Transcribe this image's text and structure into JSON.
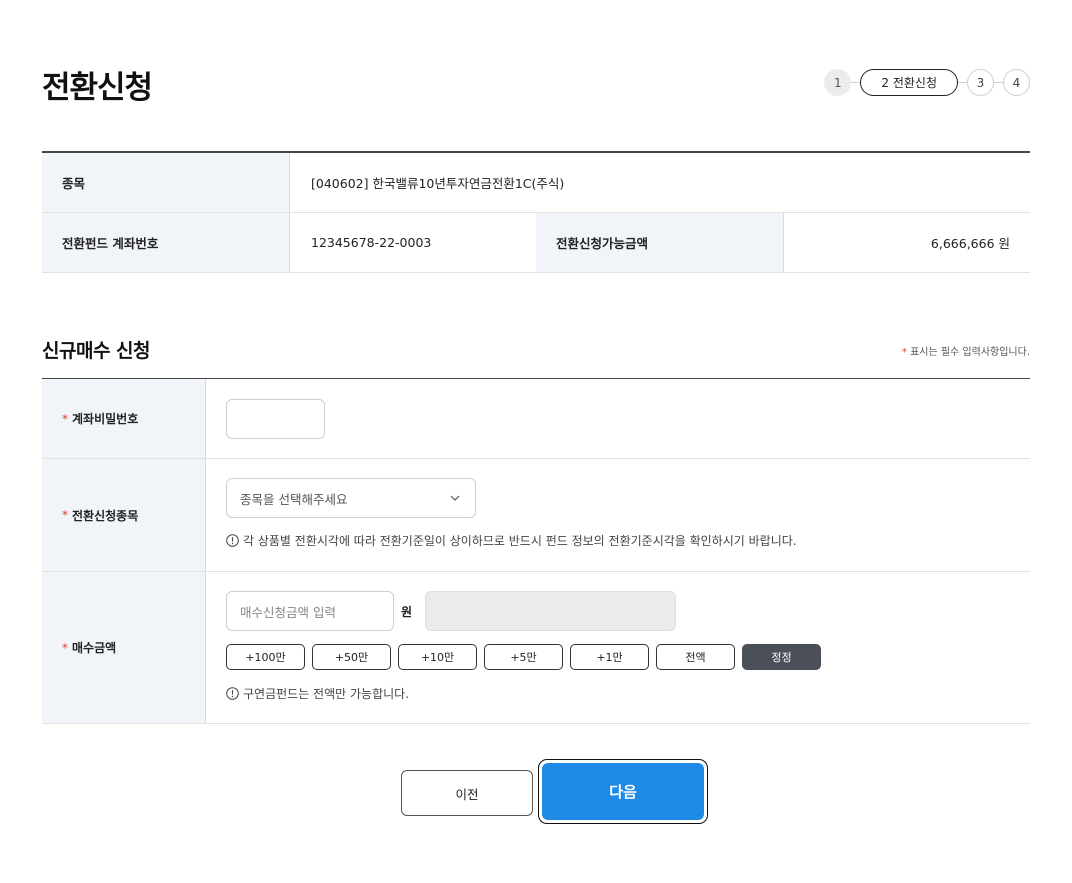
{
  "page_title": "전환신청",
  "steps": {
    "step1": "1",
    "step2": "2 전환신청",
    "step3": "3",
    "step4": "4"
  },
  "info": {
    "item_label": "종목",
    "item_value": "[040602] 한국밸류10년투자연금전환1C(주식)",
    "account_label": "전환펀드 계좌번호",
    "account_value": "12345678-22-0003",
    "available_label": "전환신청가능금액",
    "available_value": "6,666,666 원"
  },
  "section": {
    "title": "신규매수 신청",
    "required_star": "*",
    "required_note": "표시는 필수 입력사항입니다."
  },
  "form": {
    "password": {
      "label": "계좌비밀번호"
    },
    "fund": {
      "label": "전환신청종목",
      "placeholder": "종목을 선택해주세요",
      "notice": "각 상품별 전환시각에 따라 전환기준일이 상이하므로 반드시 펀드 정보의 전환기준시각을 확인하시기 바랍니다."
    },
    "amount": {
      "label": "매수금액",
      "placeholder": "매수신청금액 입력",
      "unit": "원",
      "chips": [
        "+100만",
        "+50만",
        "+10만",
        "+5만",
        "+1만",
        "전액",
        "정정"
      ],
      "notice": "구연금펀드는 전액만 가능합니다."
    }
  },
  "buttons": {
    "prev": "이전",
    "next": "다음"
  },
  "colors": {
    "primary": "#1e8ae6",
    "required": "#e03c3c",
    "header_bg": "#f1f5fa",
    "dark_chip": "#4b4f57"
  }
}
